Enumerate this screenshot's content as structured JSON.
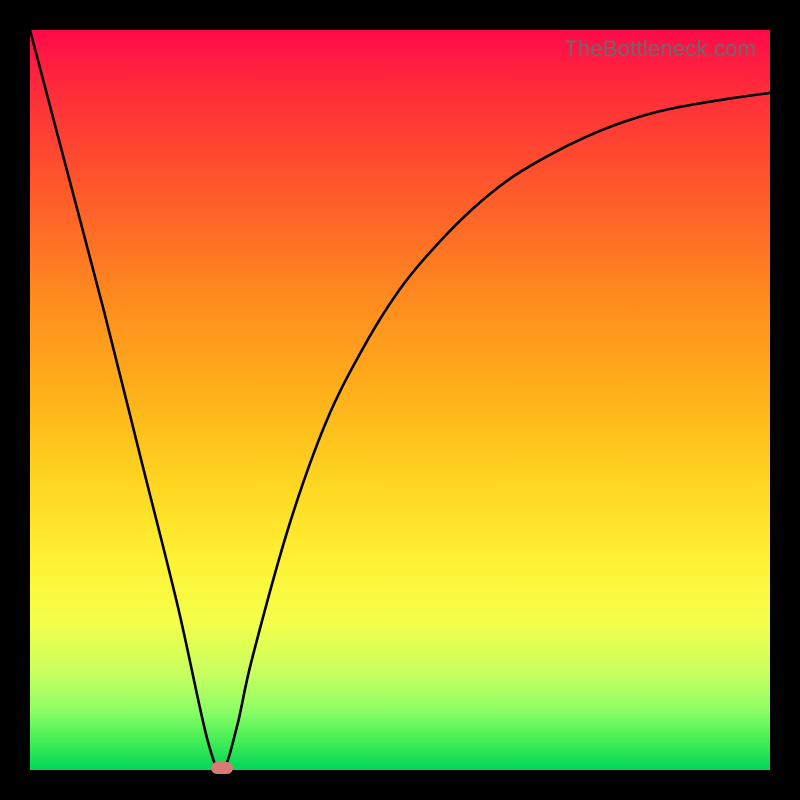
{
  "watermark": "TheBottleneck.com",
  "colors": {
    "frame": "#000000",
    "curve": "#000000",
    "marker": "#d97a74"
  },
  "chart_data": {
    "type": "line",
    "title": "",
    "xlabel": "",
    "ylabel": "",
    "xlim": [
      0,
      100
    ],
    "ylim": [
      0,
      100
    ],
    "grid": false,
    "legend": false,
    "series": [
      {
        "name": "bottleneck-curve",
        "x": [
          0,
          5,
          10,
          15,
          20,
          24,
          26,
          28,
          30,
          35,
          40,
          45,
          50,
          55,
          60,
          65,
          70,
          75,
          80,
          85,
          90,
          95,
          100
        ],
        "y": [
          100,
          81,
          62,
          42,
          22,
          4,
          0,
          6,
          15,
          33,
          47,
          57,
          65,
          71,
          76,
          80,
          83,
          85.5,
          87.5,
          89,
          90,
          90.8,
          91.5
        ]
      }
    ],
    "annotations": [
      {
        "name": "optimal-marker",
        "x": 26,
        "y": 0
      }
    ]
  }
}
